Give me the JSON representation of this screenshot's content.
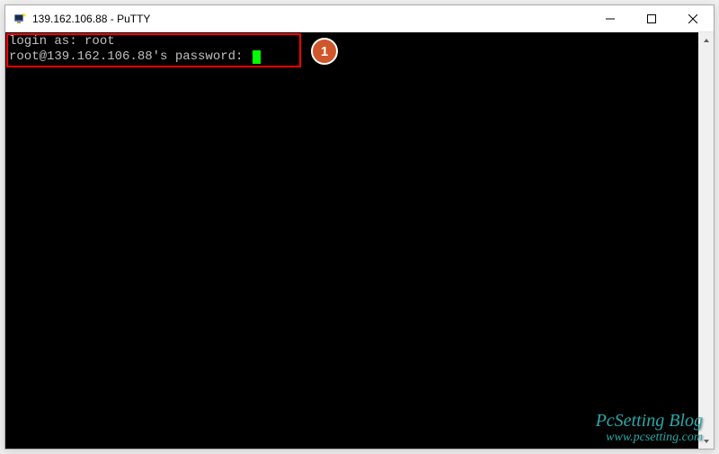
{
  "window": {
    "title": "139.162.106.88 - PuTTY"
  },
  "terminal": {
    "line1_prompt": "login as: ",
    "line1_input": "root",
    "line2_prompt": "root@139.162.106.88's password: "
  },
  "annotation": {
    "badge_number": "1"
  },
  "watermark": {
    "title": "PcSetting Blog",
    "url": "www.pcsetting.com"
  }
}
